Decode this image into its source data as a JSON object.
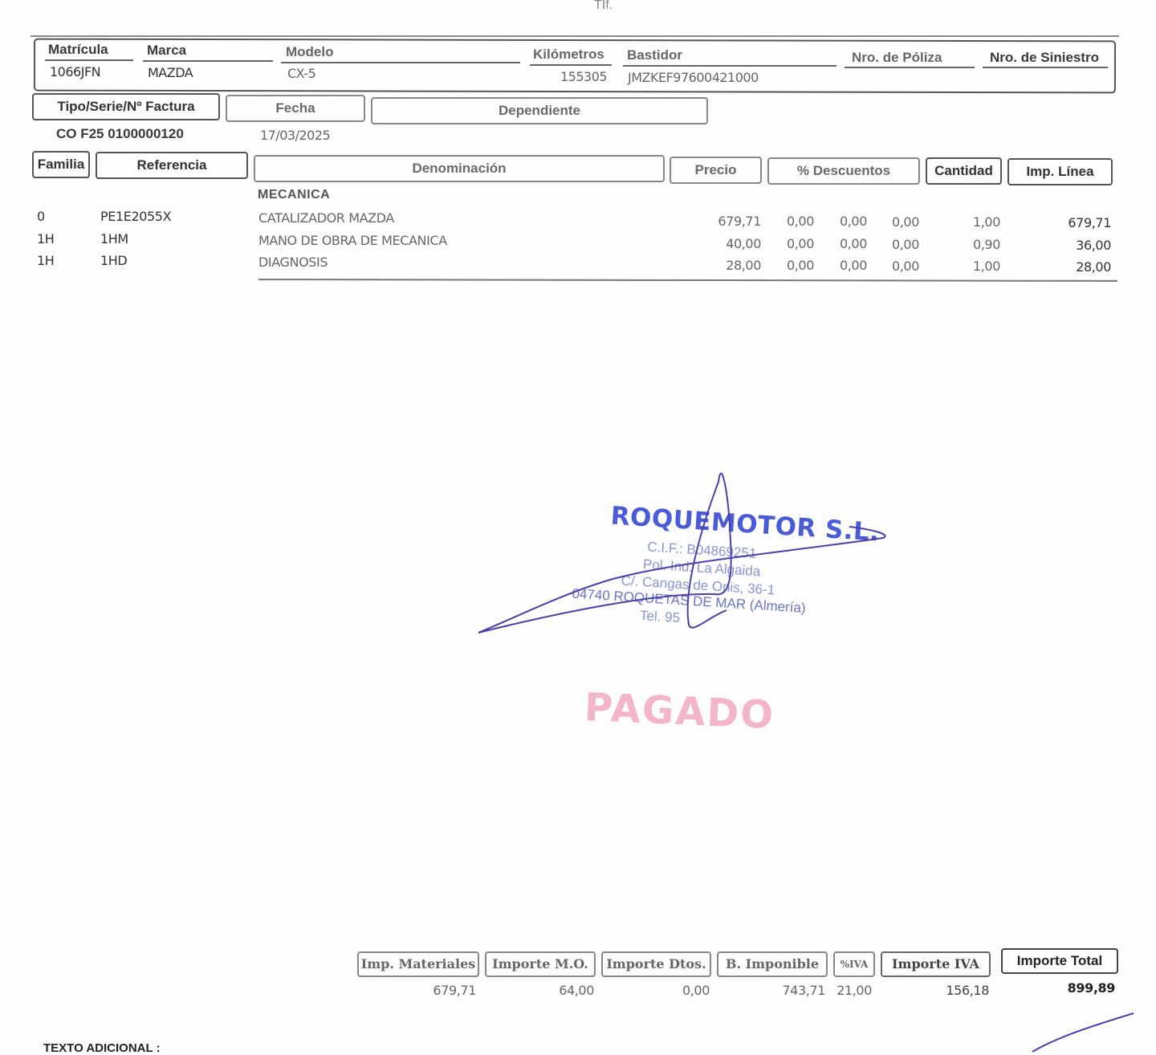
{
  "header_fragment": "TIf.",
  "vehicle": {
    "headers": {
      "matricula": "Matrícula",
      "marca": "Marca",
      "modelo": "Modelo",
      "kilometros": "Kilómetros",
      "bastidor": "Bastidor",
      "poliza": "Nro. de Póliza",
      "siniestro": "Nro. de Siniestro"
    },
    "values": {
      "matricula": "1066JFN",
      "marca": "MAZDA",
      "modelo": "CX-5",
      "kilometros": "155305",
      "bastidor": "JMZKEF97600421000"
    }
  },
  "invoice": {
    "headers": {
      "tipo": "Tipo/Serie/Nº Factura",
      "fecha": "Fecha",
      "dependiente": "Dependiente"
    },
    "values": {
      "numero": "CO F25 0100000120",
      "fecha": "17/03/2025"
    }
  },
  "lines_table": {
    "headers": {
      "familia": "Familia",
      "referencia": "Referencia",
      "denominacion": "Denominación",
      "precio": "Precio",
      "descuentos": "% Descuentos",
      "cantidad": "Cantidad",
      "imp_linea": "Imp. Línea"
    },
    "section": "MECANICA",
    "rows": [
      {
        "familia": "0",
        "referencia": "PE1E2055X",
        "denominacion": "CATALIZADOR MAZDA",
        "precio": "679,71",
        "d1": "0,00",
        "d2": "0,00",
        "d3": "0,00",
        "cantidad": "1,00",
        "importe": "679,71"
      },
      {
        "familia": "1H",
        "referencia": "1HM",
        "denominacion": "MANO DE OBRA DE MECANICA",
        "precio": "40,00",
        "d1": "0,00",
        "d2": "0,00",
        "d3": "0,00",
        "cantidad": "0,90",
        "importe": "36,00"
      },
      {
        "familia": "1H",
        "referencia": "1HD",
        "denominacion": "DIAGNOSIS",
        "precio": "28,00",
        "d1": "0,00",
        "d2": "0,00",
        "d3": "0,00",
        "cantidad": "1,00",
        "importe": "28,00"
      }
    ]
  },
  "stamp": {
    "company": "ROQUEMOTOR S.L.",
    "cif": "C.I.F.: B04869251",
    "line1": "Pol. Ind. La Algaida",
    "line2": "C/. Cangas de Onis, 36-1",
    "line3": "04740 ROQUETAS DE MAR (Almería)",
    "line4": "Tel. 95"
  },
  "paid_stamp": "PAGADO",
  "totals": {
    "headers": {
      "materiales": "Imp. Materiales",
      "mano_obra": "Importe M.O.",
      "descuentos": "Importe Dtos.",
      "base": "B. Imponible",
      "iva_pct": "%IVA",
      "iva": "Importe IVA",
      "total": "Importe Total"
    },
    "values": {
      "materiales": "679,71",
      "mano_obra": "64,00",
      "descuentos": "0,00",
      "base": "743,71",
      "iva_pct": "21,00",
      "iva": "156,18",
      "total": "899,89"
    }
  },
  "texto_adicional": "TEXTO ADICIONAL :",
  "colors": {
    "stamp_blue": "#4a5bd6",
    "signature": "#4b3fa8",
    "paid_pink": "#f2a9c2"
  }
}
